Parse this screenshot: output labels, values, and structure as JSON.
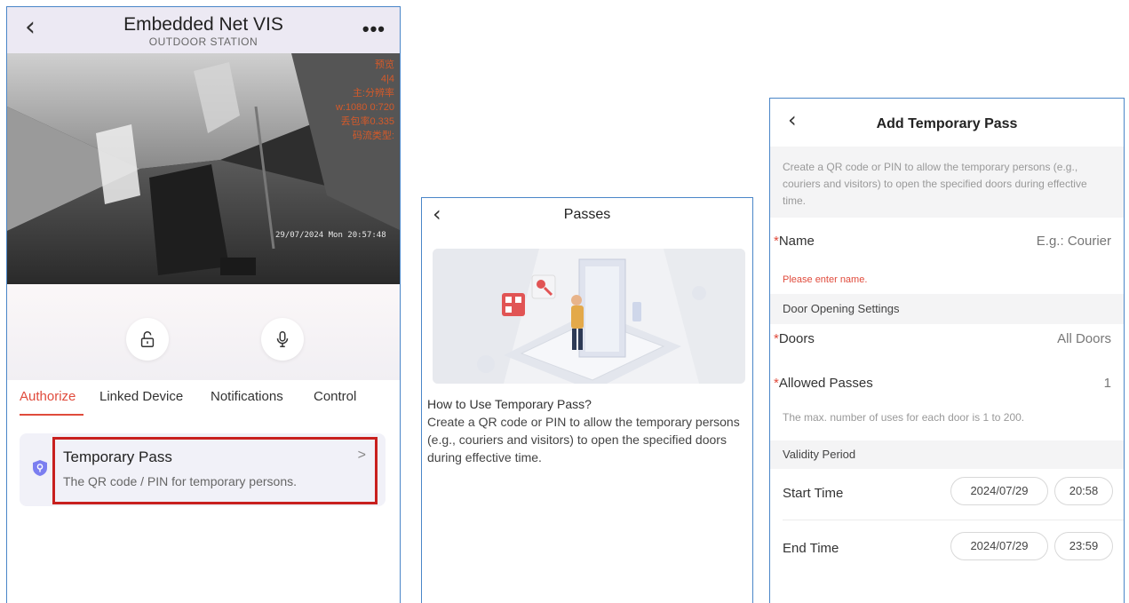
{
  "panel1": {
    "title": "Embedded Net VIS",
    "subtitle": "OUTDOOR STATION",
    "back_icon": "chevron-left",
    "more_label": "•••",
    "video_overlay": [
      "预览",
      "4|4",
      "主:分辨率",
      "w:1080 0:720",
      "丢包率0.335",
      "码流类型:"
    ],
    "video_timestamp": "29/07/2024 Mon 20:57:48",
    "tabs": [
      "Authorize",
      "Linked Device",
      "Notifications",
      "Control"
    ],
    "card": {
      "title": "Temporary Pass",
      "description": "The QR code / PIN for temporary persons.",
      "chevron": ">"
    },
    "accent_color": "#e04b3c",
    "highlight_color": "#c8201e"
  },
  "panel2": {
    "title": "Passes",
    "back_icon": "chevron-left",
    "how_to_title": "How to Use Temporary Pass?",
    "how_to_text": "Create a QR code or PIN to allow the temporary persons (e.g., couriers and visitors) to open the specified doors during effective time."
  },
  "panel3": {
    "title": "Add Temporary Pass",
    "back_icon": "chevron-left",
    "intro": "Create a QR code or PIN to allow the temporary persons (e.g., couriers and visitors) to open the specified doors during effective time.",
    "required_mark": "*",
    "name_label": "Name",
    "name_placeholder": "E.g.: Courier",
    "name_error": "Please enter name.",
    "door_section": "Door Opening Settings",
    "doors_label": "Doors",
    "doors_value": "All Doors",
    "allowed_label": "Allowed Passes",
    "allowed_value": "1",
    "allowed_hint": "The max. number of uses for each door is 1 to 200.",
    "validity_section": "Validity Period",
    "start_label": "Start Time",
    "start_date": "2024/07/29",
    "start_time": "20:58",
    "end_label": "End Time",
    "end_date": "2024/07/29",
    "end_time": "23:59"
  }
}
